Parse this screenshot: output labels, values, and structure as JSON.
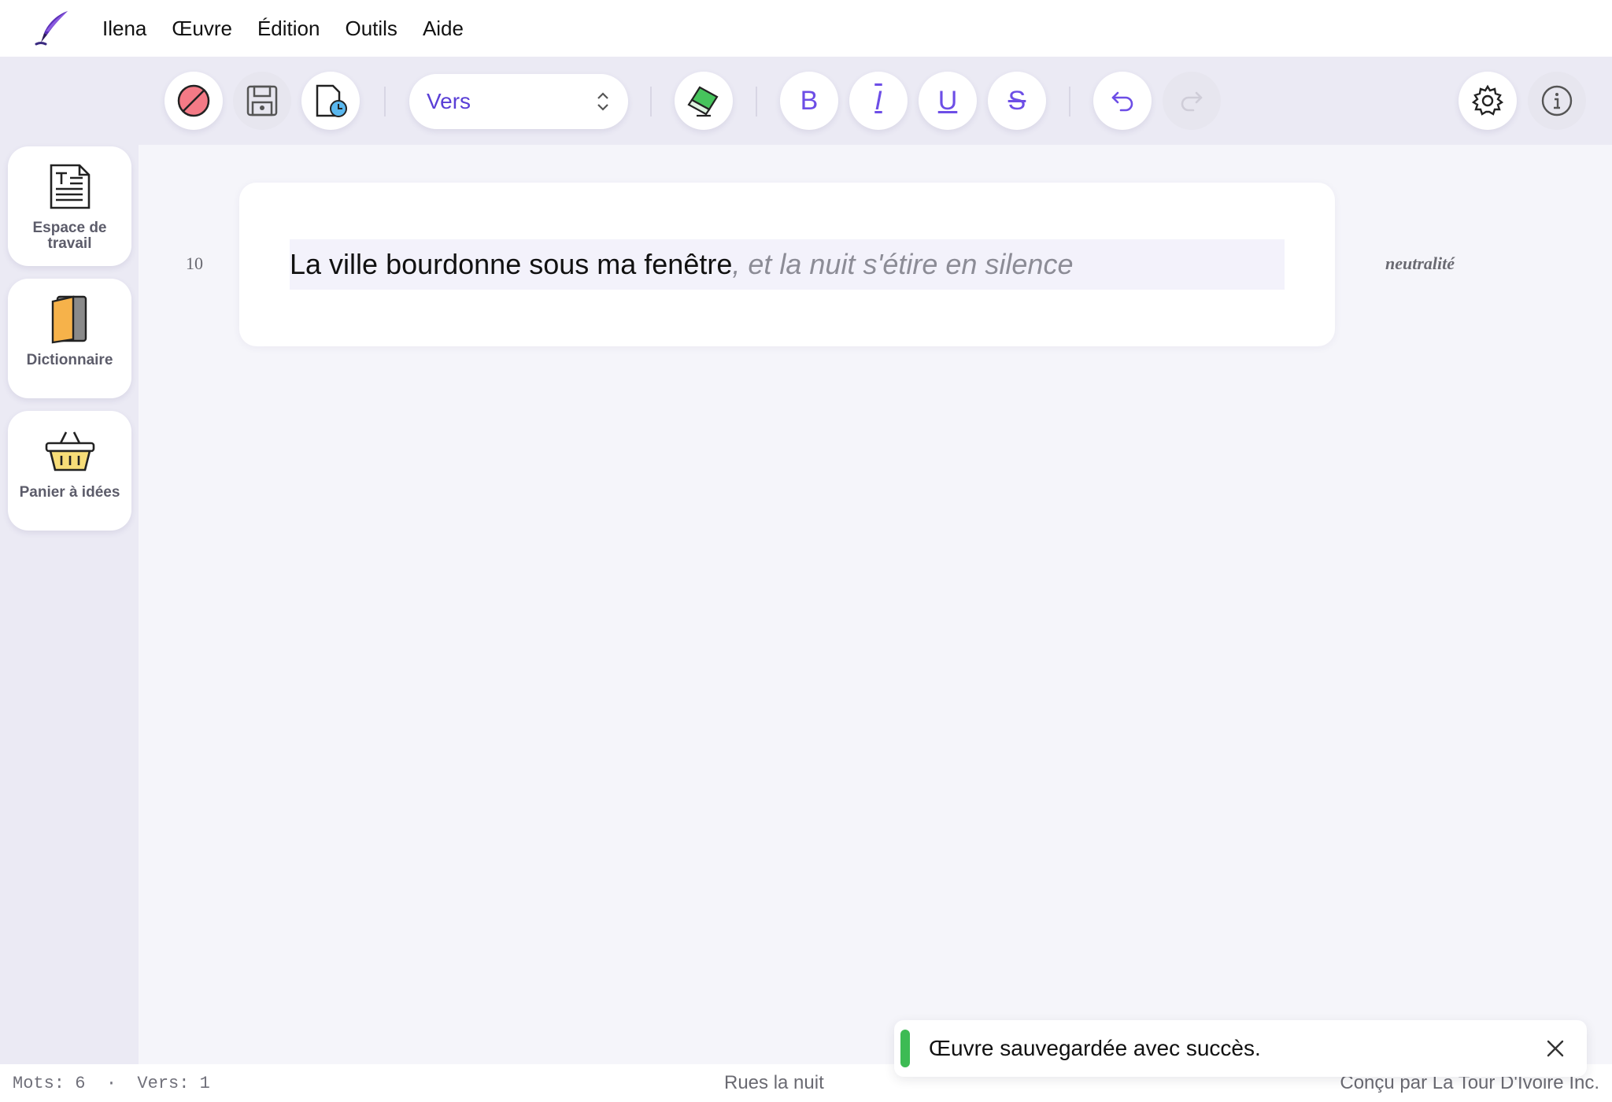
{
  "menubar": {
    "logo_icon": "quill-pen-icon",
    "items": [
      "Ilena",
      "Œuvre",
      "Édition",
      "Outils",
      "Aide"
    ]
  },
  "toolbar": {
    "buttons": [
      {
        "name": "no-record-icon"
      },
      {
        "name": "save-icon"
      },
      {
        "name": "document-history-icon"
      },
      {
        "name": "eraser-icon"
      },
      {
        "name": "bold-icon",
        "glyph": "B"
      },
      {
        "name": "italic-icon",
        "glyph": "I"
      },
      {
        "name": "underline-icon",
        "glyph": "U"
      },
      {
        "name": "strikethrough-icon",
        "glyph": "S"
      },
      {
        "name": "undo-icon"
      },
      {
        "name": "redo-icon",
        "disabled": true
      },
      {
        "name": "gear-icon"
      },
      {
        "name": "info-icon"
      }
    ],
    "mode_select": {
      "value": "Vers"
    }
  },
  "sidebar": {
    "items": [
      {
        "label": "Espace de travail",
        "icon": "document-text-icon"
      },
      {
        "label": "Dictionnaire",
        "icon": "book-icon"
      },
      {
        "label": "Panier à idées",
        "icon": "basket-icon"
      }
    ]
  },
  "editor": {
    "line_number": "10",
    "verse_text": "La ville bourdonne sous ma fenêtre",
    "ghost_suggestion": ", et la nuit s'étire en silence",
    "tone_label": "neutralité"
  },
  "statusbar": {
    "counts": "Mots: 6  ·  Vers: 1",
    "title": "Rues la nuit",
    "credit": "Conçu par La Tour D'Ivoire Inc."
  },
  "toast": {
    "message": "Œuvre sauvegardée avec succès.",
    "accent_color": "#3dbb54"
  },
  "colors": {
    "accent": "#6d4ee6",
    "chrome": "#ebeaf4",
    "canvas": "#f5f5fa"
  }
}
